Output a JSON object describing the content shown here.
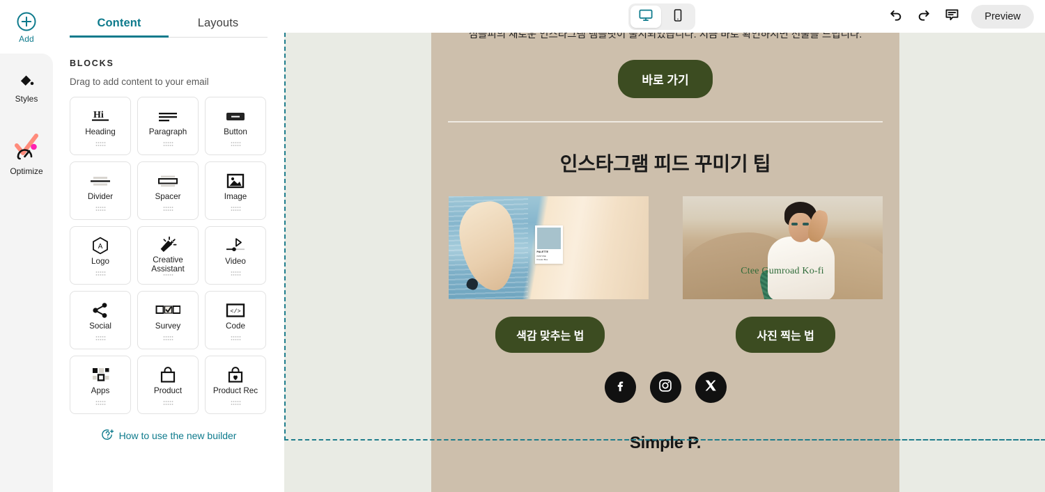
{
  "rail": {
    "add": {
      "label": "Add",
      "icon": "plus-circle-icon"
    },
    "items": [
      {
        "label": "Styles",
        "icon": "paint-bucket-icon"
      },
      {
        "label": "Optimize",
        "icon": "optimize-gauge-icon"
      }
    ]
  },
  "panel": {
    "tabs": [
      {
        "label": "Content",
        "active": true
      },
      {
        "label": "Layouts",
        "active": false
      }
    ],
    "section_title": "BLOCKS",
    "section_subtitle": "Drag to add content to your email",
    "blocks": [
      {
        "label": "Heading",
        "icon": "heading-hi-icon"
      },
      {
        "label": "Paragraph",
        "icon": "paragraph-lines-icon"
      },
      {
        "label": "Button",
        "icon": "button-pill-icon"
      },
      {
        "label": "Divider",
        "icon": "divider-line-icon"
      },
      {
        "label": "Spacer",
        "icon": "spacer-box-icon"
      },
      {
        "label": "Image",
        "icon": "image-picture-icon"
      },
      {
        "label": "Logo",
        "icon": "logo-hexagon-a-icon"
      },
      {
        "label": "Creative Assistant",
        "icon": "magic-wand-sparkle-icon"
      },
      {
        "label": "Video",
        "icon": "video-play-slider-icon"
      },
      {
        "label": "Social",
        "icon": "social-share-icon"
      },
      {
        "label": "Survey",
        "icon": "survey-checkbox-icon"
      },
      {
        "label": "Code",
        "icon": "code-brackets-icon"
      },
      {
        "label": "Apps",
        "icon": "apps-grid-icon"
      },
      {
        "label": "Product",
        "icon": "product-bag-icon"
      },
      {
        "label": "Product Rec",
        "icon": "product-rec-bag-heart-icon"
      }
    ],
    "help_link": "How to use the new builder",
    "help_icon": "question-sparkle-icon"
  },
  "topbar": {
    "devices": [
      {
        "name": "desktop",
        "icon": "desktop-monitor-icon",
        "active": true
      },
      {
        "name": "mobile",
        "icon": "mobile-phone-icon",
        "active": false
      }
    ],
    "actions": [
      {
        "name": "undo",
        "icon": "undo-arrow-icon"
      },
      {
        "name": "redo",
        "icon": "redo-arrow-icon"
      },
      {
        "name": "comment",
        "icon": "comment-bubble-icon"
      }
    ],
    "preview_label": "Preview"
  },
  "email": {
    "intro_text": "심플피의 새로운 인스타그램 템플릿이 출시되었습니다. 지금 바로 확인하시면 선물을 드립니다.",
    "cta_label": "바로 가기",
    "headline": "인스타그램 피드 꾸미기 팁",
    "images": [
      {
        "alt": "beach-dress-photo",
        "swatch_title": "PALETTE",
        "swatch_line1": "PANTONE",
        "swatch_line2": "Powder Blue"
      },
      {
        "alt": "desert-fashion-photo",
        "overlay_text": "Ctee Gumroad Ko-fi"
      }
    ],
    "buttons": [
      {
        "label": "색감 맞추는 법"
      },
      {
        "label": "사진 찍는 법"
      }
    ],
    "social": [
      {
        "name": "facebook",
        "icon": "facebook-icon",
        "glyph": "f"
      },
      {
        "name": "instagram",
        "icon": "instagram-icon",
        "glyph": ""
      },
      {
        "name": "x-twitter",
        "icon": "x-twitter-icon",
        "glyph": "𝕏"
      }
    ],
    "footer_brand": "Simple P."
  },
  "colors": {
    "accent_teal": "#0d7a8c",
    "selection_teal": "#1f7d8c",
    "email_bg": "#cdbfac",
    "canvas_bg": "#e9ebe4",
    "button_green": "#3c4c21"
  }
}
